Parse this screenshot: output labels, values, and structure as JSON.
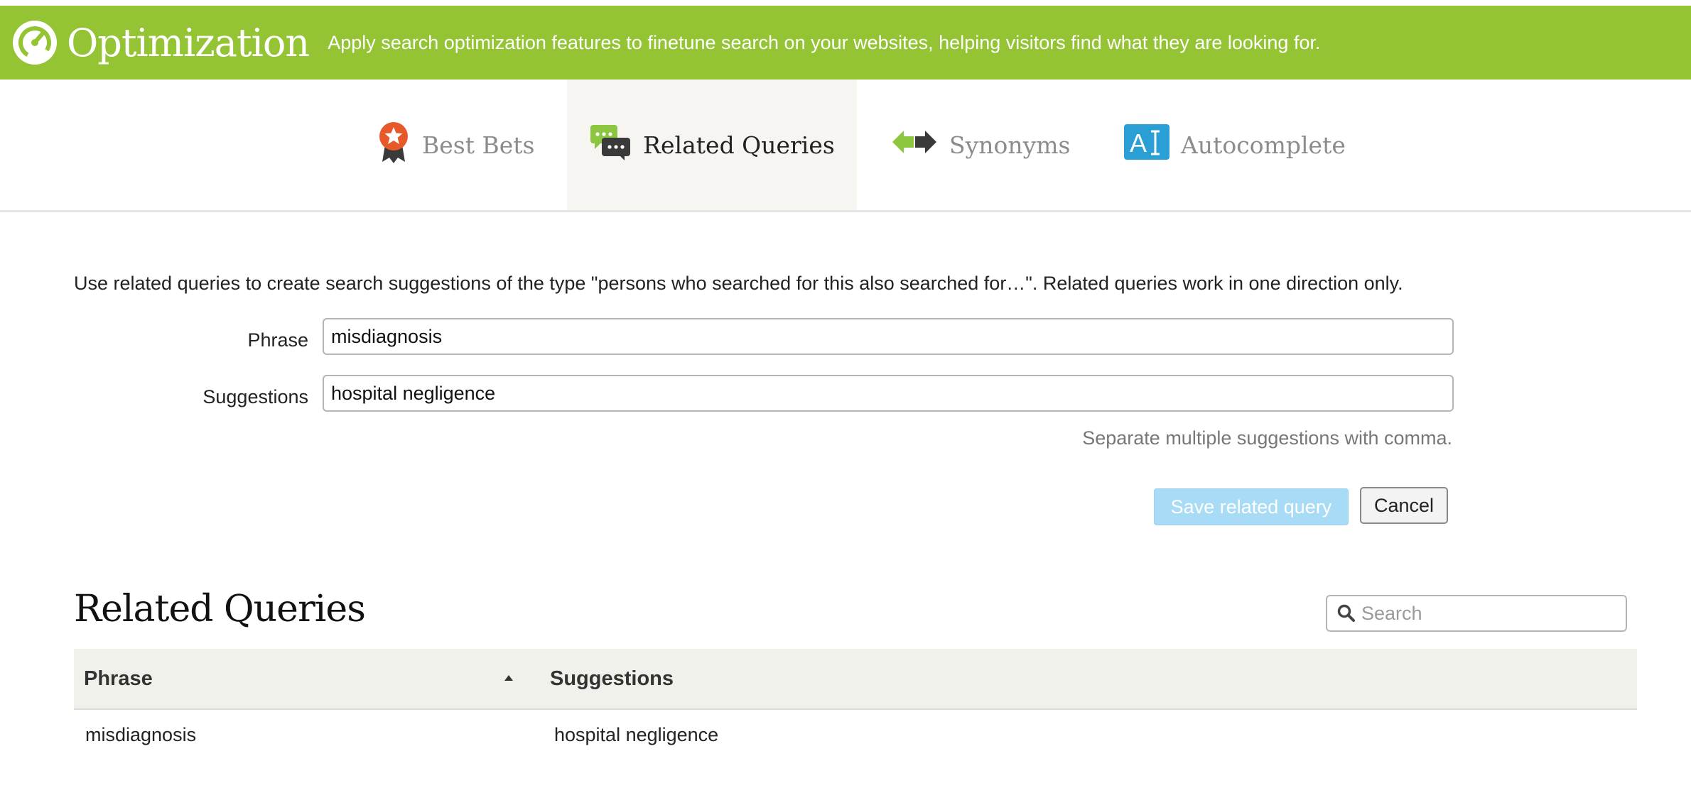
{
  "header": {
    "title": "Optimization",
    "description": "Apply search optimization features to finetune search on your websites, helping visitors find what they are looking for.",
    "logo_icon": "gauge-icon",
    "bg_color": "#94c434"
  },
  "tabs": [
    {
      "label": "Best Bets",
      "icon": "award-ribbon-icon",
      "active": false
    },
    {
      "label": "Related Queries",
      "icon": "chat-bubbles-icon",
      "active": true
    },
    {
      "label": "Synonyms",
      "icon": "double-arrow-icon",
      "active": false
    },
    {
      "label": "Autocomplete",
      "icon": "text-cursor-icon",
      "active": false
    }
  ],
  "form": {
    "intro": "Use related queries to create search suggestions of the type \"persons who searched for this also searched for…\". Related queries work in one direction only.",
    "phrase_label": "Phrase",
    "phrase_value": "misdiagnosis",
    "suggestions_label": "Suggestions",
    "suggestions_value": "hospital negligence",
    "hint": "Separate multiple suggestions with comma.",
    "save_label": "Save related query",
    "cancel_label": "Cancel"
  },
  "list": {
    "title": "Related Queries",
    "search_placeholder": "Search",
    "columns": [
      "Phrase",
      "Suggestions"
    ],
    "sort_indicator": "ascending",
    "rows": [
      {
        "phrase": "misdiagnosis",
        "suggestions": "hospital negligence"
      }
    ]
  }
}
